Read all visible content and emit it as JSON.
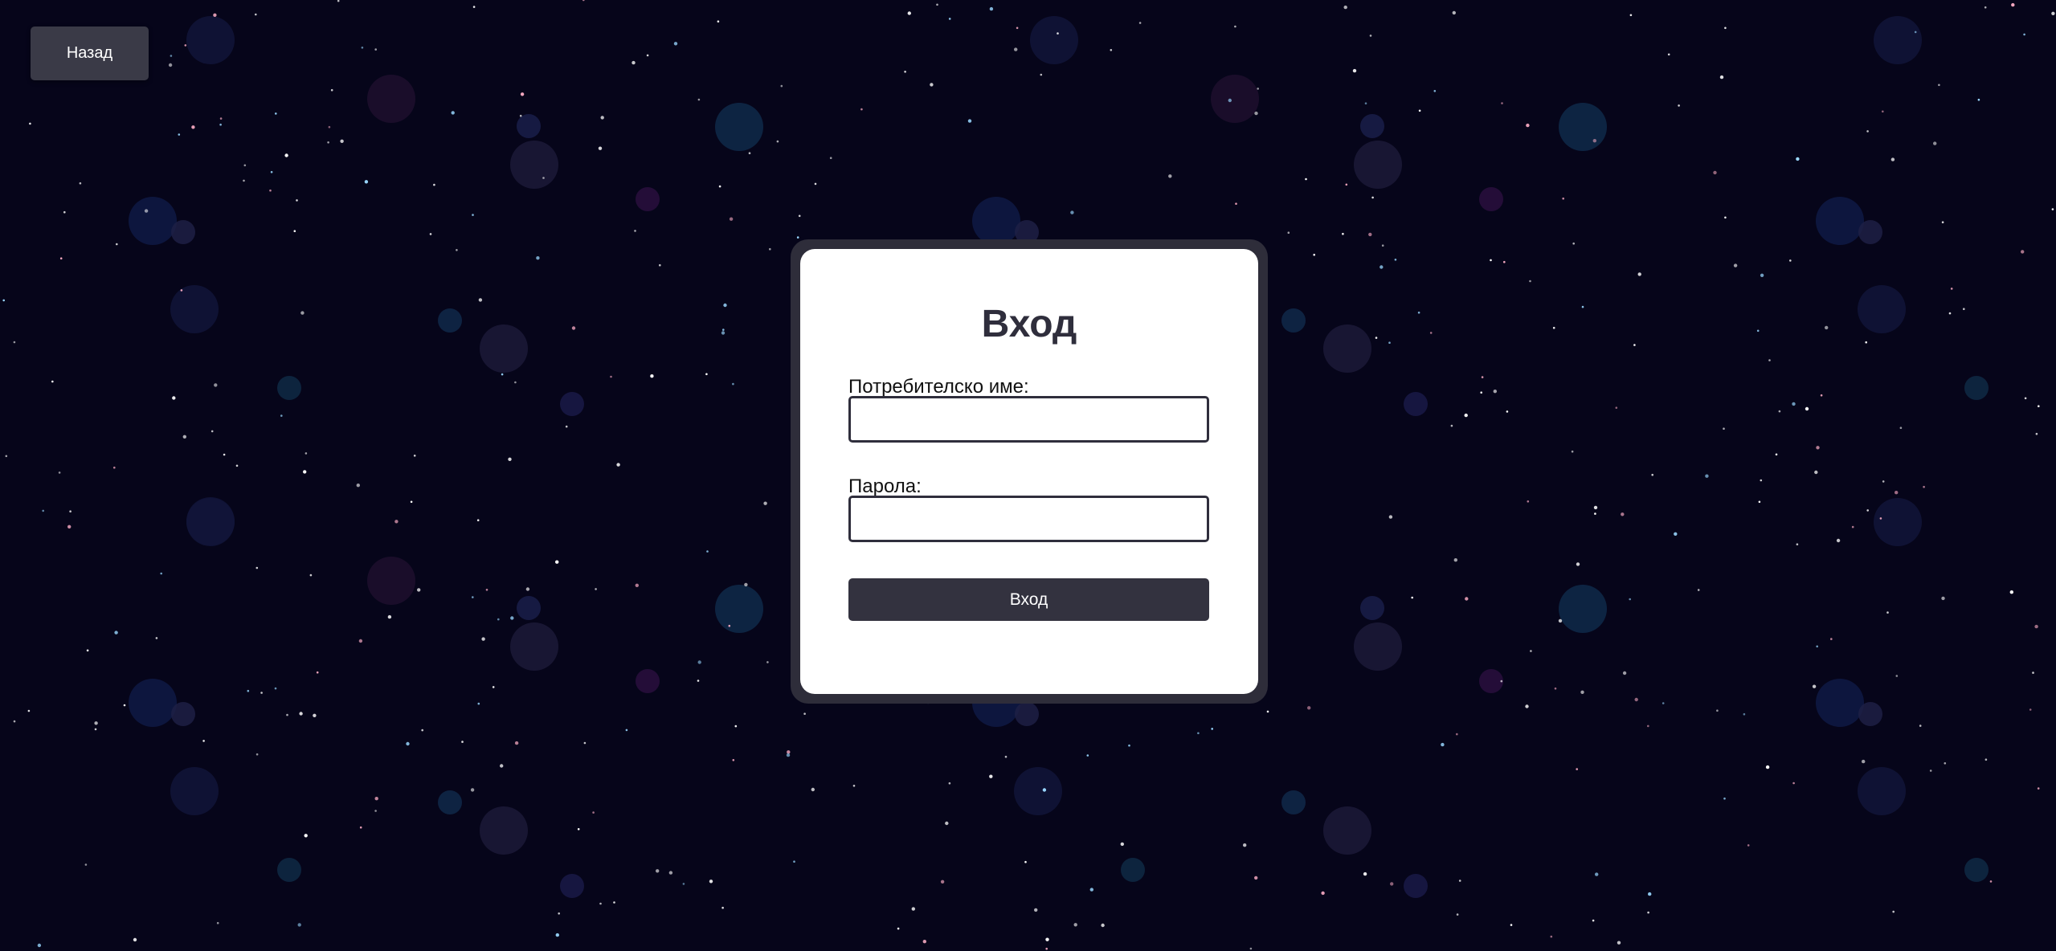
{
  "nav": {
    "back_label": "Назад"
  },
  "login": {
    "title": "Вход",
    "username_label": "Потребителско име:",
    "username_value": "",
    "password_label": "Парола:",
    "password_value": "",
    "submit_label": "Вход"
  },
  "colors": {
    "background": "#06051a",
    "card_frame": "#2e2d3a",
    "card": "#ffffff",
    "accent": "#33323f",
    "title_text": "#2f2e3c"
  }
}
